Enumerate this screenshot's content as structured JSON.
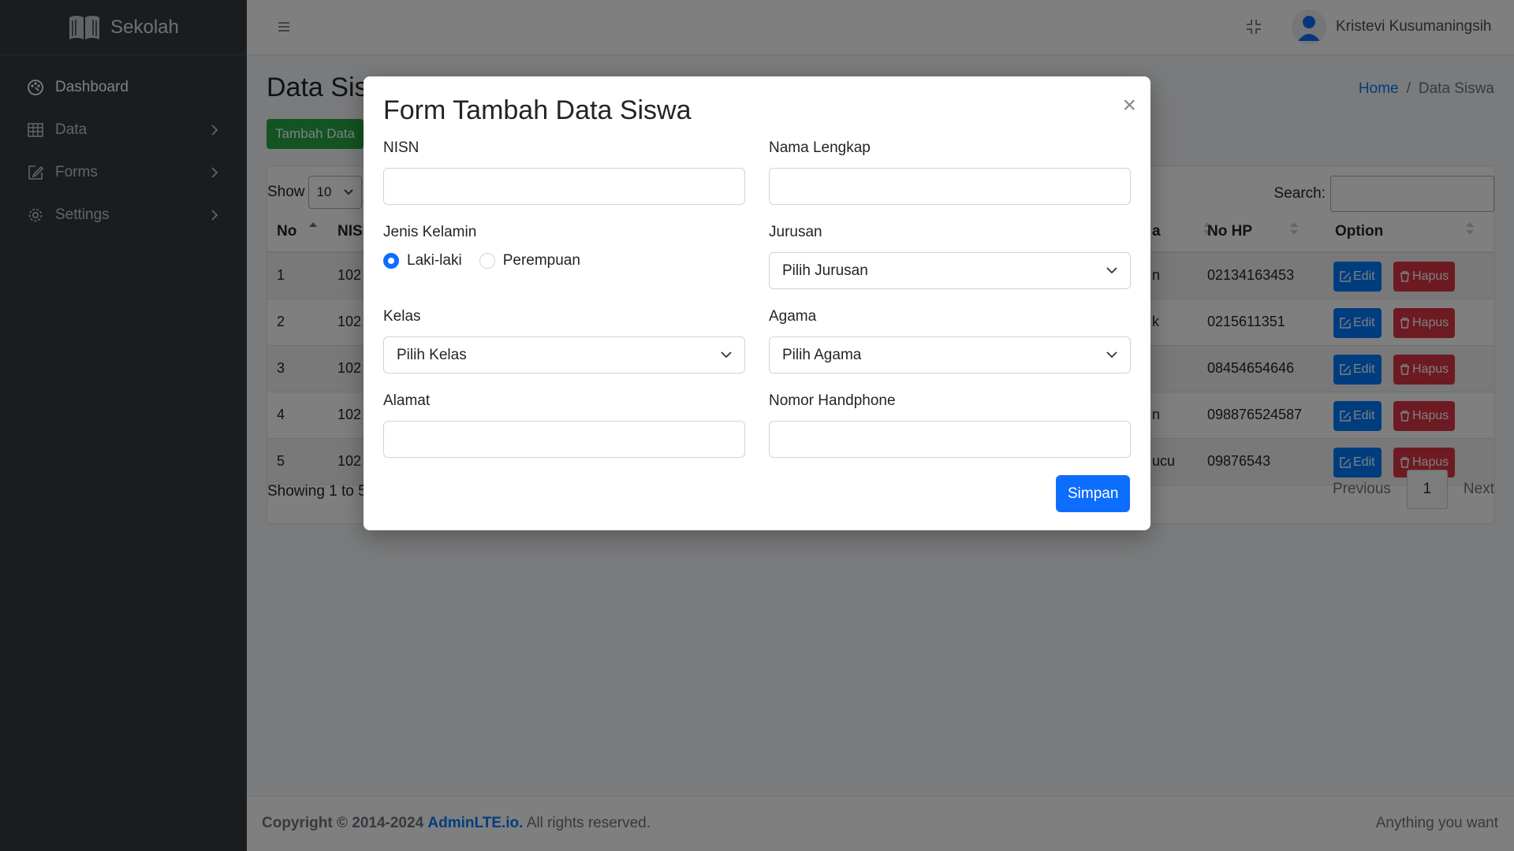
{
  "brand": {
    "name": "Sekolah",
    "icon": "book-open-icon"
  },
  "sidebar": {
    "items": [
      {
        "label": "Dashboard",
        "icon": "palette-icon",
        "has_children": false
      },
      {
        "label": "Data",
        "icon": "table-icon",
        "has_children": true
      },
      {
        "label": "Forms",
        "icon": "pencil-square-icon",
        "has_children": true
      },
      {
        "label": "Settings",
        "icon": "gear-icon",
        "has_children": true
      }
    ]
  },
  "header": {
    "user_name": "Kristevi Kusumaningsih"
  },
  "page": {
    "title": "Data Siswa",
    "breadcrumb": {
      "home": "Home",
      "separator": "/",
      "current": "Data Siswa"
    },
    "add_button": "Tambah Data"
  },
  "table": {
    "show_label": "Show",
    "show_value": "10",
    "search_label": "Search:",
    "columns": {
      "no": "No",
      "nisn": "NISN",
      "partial_col": "a",
      "phone": "No HP",
      "option": "Option"
    },
    "rows": [
      {
        "no": "1",
        "nisn": "102",
        "partial": "n",
        "phone": "02134163453"
      },
      {
        "no": "2",
        "nisn": "102",
        "partial": "k",
        "phone": "0215611351"
      },
      {
        "no": "3",
        "nisn": "102",
        "partial": "",
        "phone": "08454654646"
      },
      {
        "no": "4",
        "nisn": "102",
        "partial": "n",
        "phone": "098876524587"
      },
      {
        "no": "5",
        "nisn": "102",
        "partial": "ucu",
        "phone": "09876543"
      }
    ],
    "edit_label": "Edit",
    "delete_label": "Hapus",
    "info": "Showing 1 to 5",
    "pager": {
      "previous": "Previous",
      "page": "1",
      "next": "Next"
    }
  },
  "footer": {
    "copyright": "Copyright © 2014-2024",
    "link": "AdminLTE.io.",
    "rights": "All rights reserved.",
    "right_text": "Anything you want"
  },
  "modal": {
    "title": "Form Tambah Data Siswa",
    "close": "×",
    "nisn_label": "NISN",
    "nama_label": "Nama Lengkap",
    "gender_label": "Jenis Kelamin",
    "gender_options": [
      "Laki-laki",
      "Perempuan"
    ],
    "gender_selected": "Laki-laki",
    "jurusan_label": "Jurusan",
    "jurusan_value": "Pilih Jurusan",
    "kelas_label": "Kelas",
    "kelas_value": "Pilih Kelas",
    "agama_label": "Agama",
    "agama_value": "Pilih Agama",
    "alamat_label": "Alamat",
    "hp_label": "Nomor Handphone",
    "save_button": "Simpan"
  },
  "colors": {
    "primary": "#0d6efd",
    "sidebar": "#343a40",
    "success": "#28a745",
    "danger": "#dc3545"
  }
}
